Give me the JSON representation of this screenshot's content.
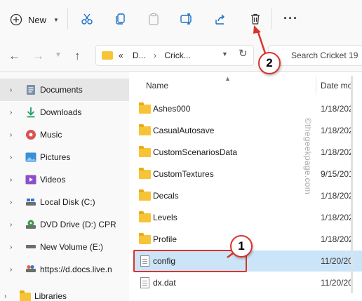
{
  "toolbar": {
    "new_label": "New",
    "icons": [
      "cut-icon",
      "copy-icon",
      "paste-icon",
      "rename-icon",
      "share-icon",
      "delete-icon",
      "more-icon"
    ],
    "more_label": "···"
  },
  "address": {
    "prefix": "«",
    "segments": [
      "D...",
      "Crick..."
    ],
    "separator": "›",
    "search_placeholder": "Search Cricket 19"
  },
  "sidebar": {
    "items": [
      {
        "label": "Documents",
        "icon": "documents-icon",
        "selected": true
      },
      {
        "label": "Downloads",
        "icon": "downloads-icon"
      },
      {
        "label": "Music",
        "icon": "music-icon"
      },
      {
        "label": "Pictures",
        "icon": "pictures-icon"
      },
      {
        "label": "Videos",
        "icon": "videos-icon"
      },
      {
        "label": "Local Disk (C:)",
        "icon": "drive-icon"
      },
      {
        "label": "DVD Drive (D:) CPR",
        "icon": "dvd-drive-icon"
      },
      {
        "label": "New Volume (E:)",
        "icon": "drive-icon"
      },
      {
        "label": "https://d.docs.live.n",
        "icon": "network-drive-icon"
      },
      {
        "label": "Libraries",
        "icon": "libraries-icon"
      }
    ]
  },
  "filelist": {
    "col_name": "Name",
    "col_date": "Date mo",
    "rows": [
      {
        "name": "Ashes000",
        "date": "1/18/202",
        "type": "folder"
      },
      {
        "name": "CasualAutosave",
        "date": "1/18/202",
        "type": "folder"
      },
      {
        "name": "CustomScenariosData",
        "date": "1/18/202",
        "type": "folder"
      },
      {
        "name": "CustomTextures",
        "date": "9/15/201",
        "type": "folder"
      },
      {
        "name": "Decals",
        "date": "1/18/202",
        "type": "folder"
      },
      {
        "name": "Levels",
        "date": "1/18/202",
        "type": "folder"
      },
      {
        "name": "Profile",
        "date": "1/18/202",
        "type": "folder"
      },
      {
        "name": "config",
        "date": "11/20/20",
        "type": "file",
        "selected": true
      },
      {
        "name": "dx.dat",
        "date": "11/20/20",
        "type": "file"
      }
    ]
  },
  "watermark": "©thegeekpage.com",
  "annotations": {
    "badge_1": "1",
    "badge_2": "2"
  },
  "colors": {
    "accent": "#d9342b",
    "selection": "#cce4f7",
    "folder": "#f8c437"
  }
}
